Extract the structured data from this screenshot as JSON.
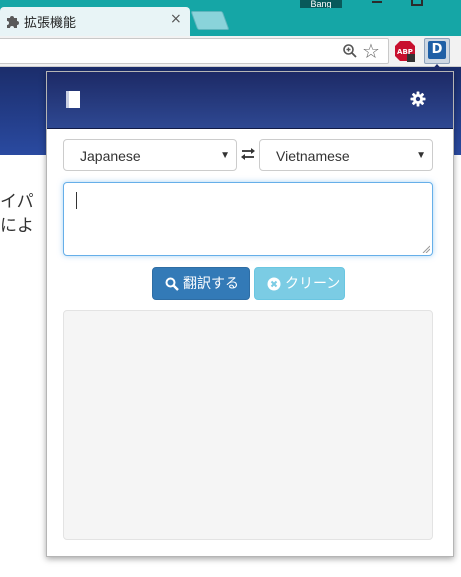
{
  "browser": {
    "tab": {
      "title": "拡張機能",
      "close_label": "×"
    },
    "profile_name": "Bang",
    "star_glyph": "☆"
  },
  "page": {
    "line1": "イパ",
    "line2": "によ"
  },
  "popup": {
    "header": {
      "book_icon": "book-icon",
      "settings_icon": "gear-icon"
    },
    "source_language": {
      "value": "Japanese",
      "arrow": "▼"
    },
    "target_language": {
      "value": "Vietnamese",
      "arrow": "▼"
    },
    "input_text": "",
    "translate_button": {
      "label": "翻訳する",
      "icon": "search-icon"
    },
    "clear_button": {
      "label": "クリーン",
      "icon": "close-circle-icon"
    },
    "result_text": ""
  },
  "colors": {
    "titlebar": "#15a6a6",
    "header": "#1d2a66",
    "primary": "#337ab7",
    "info": "#5bc0de",
    "focus": "#66afe9"
  }
}
